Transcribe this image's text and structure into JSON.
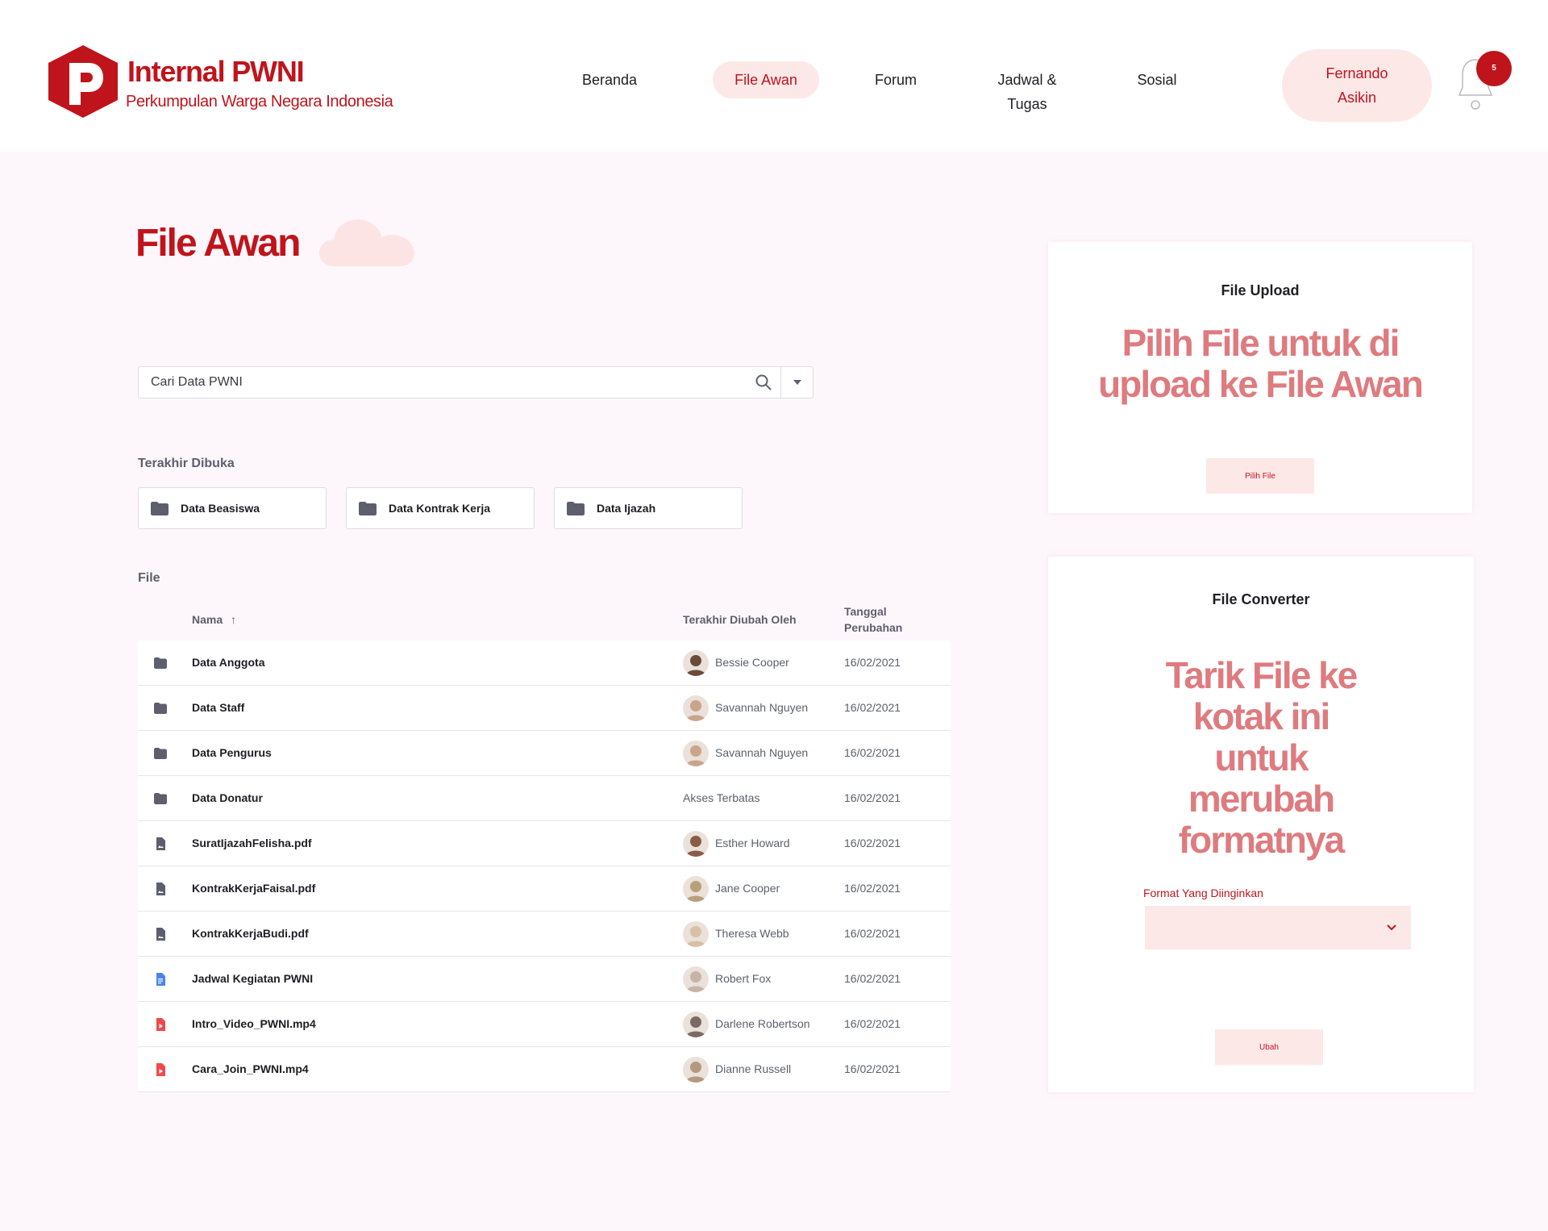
{
  "brand": {
    "title": "Internal PWNI",
    "subtitle": "Perkumpulan Warga Negara Indonesia",
    "color": "#c0141c"
  },
  "nav": {
    "items": [
      {
        "label": "Beranda"
      },
      {
        "label": "File Awan",
        "active": true
      },
      {
        "label": "Forum"
      },
      {
        "label": "Jadwal &\nTugas"
      },
      {
        "label": "Sosial"
      }
    ],
    "user_name": "Fernando\nAsikin",
    "notification_count": "5"
  },
  "page": {
    "title": "File Awan"
  },
  "search": {
    "placeholder": "Cari Data PWNI"
  },
  "recent": {
    "label": "Terakhir Dibuka",
    "items": [
      {
        "label": "Data Beasiswa",
        "icon": "folder-icon"
      },
      {
        "label": "Data Kontrak Kerja",
        "icon": "folder-icon"
      },
      {
        "label": "Data Ijazah",
        "icon": "folder-icon"
      }
    ]
  },
  "files": {
    "label": "File",
    "columns": {
      "name": "Nama",
      "modified_by": "Terakhir Diubah Oleh",
      "date": "Tanggal\nPerubahan"
    },
    "rows": [
      {
        "name": "Data Anggota",
        "icon": "folder-icon",
        "user": "Bessie Cooper",
        "date": "16/02/2021",
        "avatar": "#6b4a3a"
      },
      {
        "name": "Data Staff",
        "icon": "folder-icon",
        "user": "Savannah Nguyen",
        "date": "16/02/2021",
        "avatar": "#c9a58c"
      },
      {
        "name": "Data Pengurus",
        "icon": "folder-icon",
        "user": "Savannah Nguyen",
        "date": "16/02/2021",
        "avatar": "#c9a58c"
      },
      {
        "name": "Data Donatur",
        "icon": "folder-icon",
        "user": "Akses Terbatas",
        "date": "16/02/2021",
        "avatar": null
      },
      {
        "name": "SuratIjazahFelisha.pdf",
        "icon": "document-icon",
        "user": "Esther Howard",
        "date": "16/02/2021",
        "avatar": "#8a5c45"
      },
      {
        "name": "KontrakKerjaFaisal.pdf",
        "icon": "document-icon",
        "user": "Jane Cooper",
        "date": "16/02/2021",
        "avatar": "#b8a07a"
      },
      {
        "name": "KontrakKerjaBudi.pdf",
        "icon": "document-icon",
        "user": "Theresa Webb",
        "date": "16/02/2021",
        "avatar": "#d9bfa8"
      },
      {
        "name": "Jadwal Kegiatan PWNI",
        "icon": "google-doc-icon",
        "user": "Robert Fox",
        "date": "16/02/2021",
        "avatar": "#c8b4a6"
      },
      {
        "name": "Intro_Video_PWNI.mp4",
        "icon": "video-file-icon",
        "user": "Darlene Robertson",
        "date": "16/02/2021",
        "avatar": "#7a6a64"
      },
      {
        "name": "Cara_Join_PWNI.mp4",
        "icon": "video-file-icon",
        "user": "Dianne Russell",
        "date": "16/02/2021",
        "avatar": "#b49880"
      }
    ]
  },
  "upload_card": {
    "title": "File Upload",
    "headline": "Pilih File untuk di upload ke File Awan",
    "button": "Pilih File"
  },
  "converter_card": {
    "title": "File Converter",
    "headline": "Tarik File ke kotak ini untuk merubah formatnya",
    "format_label": "Format Yang Diinginkan",
    "format_value": "",
    "button": "Ubah"
  },
  "colors": {
    "accent": "#c0141c",
    "accent_soft": "#fde8e8",
    "headline_pink": "#de7b7f",
    "page_bg": "#fdf7fb"
  }
}
